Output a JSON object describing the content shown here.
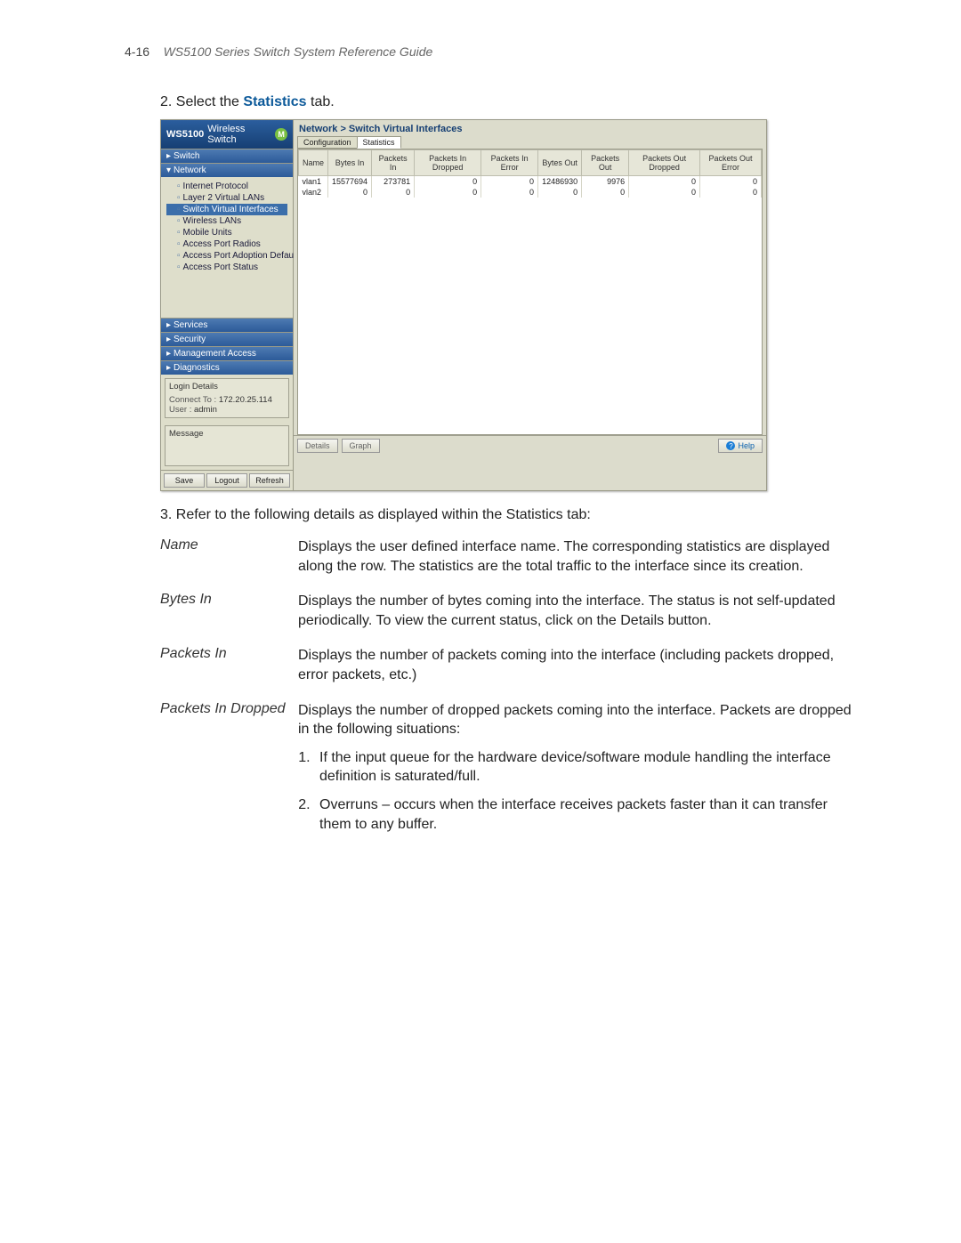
{
  "header": {
    "pagenum": "4-16",
    "title": "WS5100 Series Switch System Reference Guide"
  },
  "step2_pre": "2. Select the",
  "step2_hl": "Statistics",
  "step2_post": "tab.",
  "step3": "3. Refer to the following details as displayed within the Statistics tab:",
  "app": {
    "brand_strong": "WS5100",
    "brand_light": "Wireless Switch",
    "logo": "M",
    "sections": {
      "switch": "Switch",
      "network": "Network",
      "services": "Services",
      "security": "Security",
      "management": "Management Access",
      "diagnostics": "Diagnostics"
    },
    "tree": [
      "Internet Protocol",
      "Layer 2 Virtual LANs",
      "Switch Virtual Interfaces",
      "Wireless LANs",
      "Mobile Units",
      "Access Port Radios",
      "Access Port Adoption Defaults",
      "Access Port Status"
    ],
    "selected_tree_index": 2,
    "login": {
      "legend": "Login Details",
      "connect_lbl": "Connect To :",
      "connect_val": "172.20.25.114",
      "user_lbl": "User :",
      "user_val": "admin"
    },
    "message_lbl": "Message",
    "sbuttons": {
      "save": "Save",
      "logout": "Logout",
      "refresh": "Refresh"
    },
    "crumb": "Network > Switch Virtual Interfaces",
    "tabs": {
      "config": "Configuration",
      "stats": "Statistics"
    },
    "columns": [
      "Name",
      "Bytes In",
      "Packets In",
      "Packets In Dropped",
      "Packets In Error",
      "Bytes Out",
      "Packets Out",
      "Packets Out Dropped",
      "Packets Out Error"
    ],
    "rows": [
      {
        "name": "vlan1",
        "bi": "15577694",
        "pi": "273781",
        "pid": "0",
        "pie": "0",
        "bo": "12486930",
        "po": "9976",
        "pod": "0",
        "poe": "0"
      },
      {
        "name": "vlan2",
        "bi": "0",
        "pi": "0",
        "pid": "0",
        "pie": "0",
        "bo": "0",
        "po": "0",
        "pod": "0",
        "poe": "0"
      }
    ],
    "bbuttons": {
      "details": "Details",
      "graph": "Graph",
      "help": "Help"
    }
  },
  "defs": [
    {
      "term": "Name",
      "desc": "Displays the user defined interface name. The corresponding statistics are displayed along the row. The statistics are the total traffic to the interface since its creation."
    },
    {
      "term": "Bytes In",
      "desc": "Displays the number of bytes coming into the interface. The status is not self-updated periodically. To view the current status, click on the Details button."
    },
    {
      "term": "Packets In",
      "desc": "Displays the number of packets coming into the interface (including packets dropped, error packets, etc.)"
    },
    {
      "term": "Packets In Dropped",
      "desc": "Displays the number of dropped packets coming into the interface. Packets are dropped in the following situations:",
      "list": [
        "If the input queue for the hardware device/software module handling the interface definition is saturated/full.",
        "Overruns – occurs when the interface receives packets faster than it can transfer them to any buffer."
      ]
    }
  ]
}
